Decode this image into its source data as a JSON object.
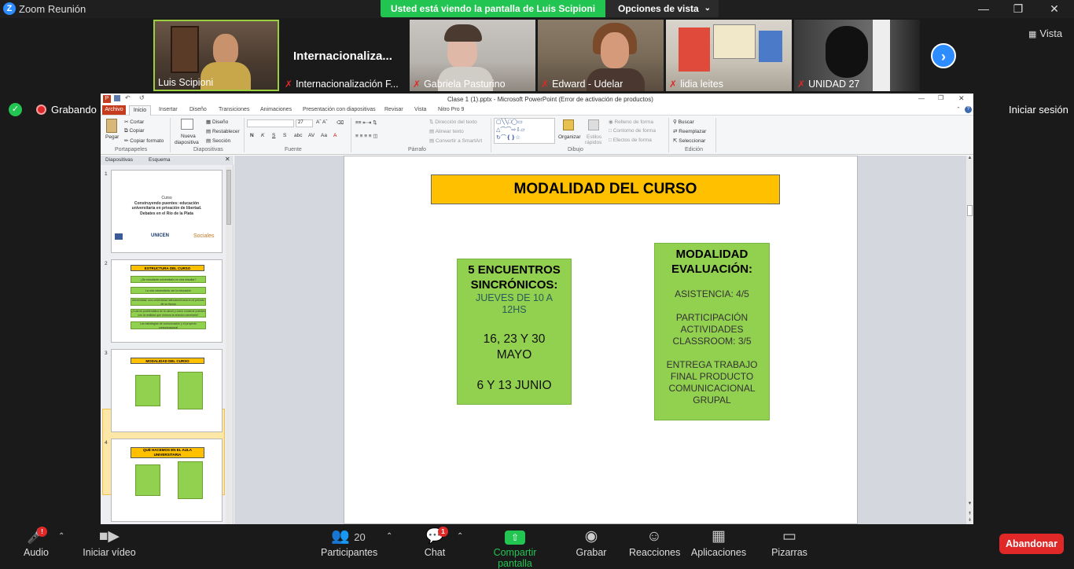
{
  "window": {
    "title": "Zoom Reunión",
    "share_banner": "Usted está viendo la pantalla de Luis Scipioni",
    "view_options": "Opciones de vista",
    "vista": "Vista"
  },
  "participants": [
    {
      "name": "Luis Scipioni",
      "muted": false
    },
    {
      "name": "Internacionalización F...",
      "muted": true,
      "display": "Internacionaliza..."
    },
    {
      "name": "Gabriela Pasturino",
      "muted": true
    },
    {
      "name": "Edward - Udelar",
      "muted": true
    },
    {
      "name": "lidia leites",
      "muted": true
    },
    {
      "name": "UNIDAD 27",
      "muted": true
    }
  ],
  "status": {
    "recording": "Grabando",
    "signin": "Iniciar sesión"
  },
  "ppt": {
    "title": "Clase 1 (1).pptx - Microsoft PowerPoint (Error de activación de productos)",
    "tabs": [
      "Archivo",
      "Inicio",
      "Insertar",
      "Diseño",
      "Transiciones",
      "Animaciones",
      "Presentación con diapositivas",
      "Revisar",
      "Vista",
      "Nitro Pro 9"
    ],
    "ribbon": {
      "portapapeles": {
        "label": "Portapapeles",
        "pegar": "Pegar",
        "cortar": "Cortar",
        "copiar": "Copiar",
        "copiar_formato": "Copiar formato"
      },
      "diapositivas": {
        "label": "Diapositivas",
        "nueva": "Nueva",
        "nueva2": "diapositiva",
        "diseno": "Diseño",
        "restablecer": "Restablecer",
        "seccion": "Sección"
      },
      "fuente": {
        "label": "Fuente",
        "size": "27"
      },
      "parrafo": {
        "label": "Párrafo",
        "direccion": "Dirección del texto",
        "alinear": "Alinear texto",
        "smartart": "Convertir a SmartArt"
      },
      "dibujo": {
        "label": "Dibujo",
        "organizar": "Organizar",
        "estilos": "Estilos",
        "estilos2": "rápidos",
        "relleno": "Relleno de forma",
        "contorno": "Contorno de forma",
        "efectos": "Efectos de forma"
      },
      "edicion": {
        "label": "Edición",
        "buscar": "Buscar",
        "reemplazar": "Reemplazar",
        "seleccionar": "Seleccionar"
      }
    },
    "panel_tabs": [
      "Diapositivas",
      "Esquema"
    ],
    "thumb1": {
      "line1": "Curso",
      "line2": "Construyendo puentes: educación",
      "line3": "universitaria en privación de libertad.",
      "line4": "Debates en el Río de la Plata",
      "logo_unicen": "UNICEN",
      "logo_sociales": "Sociales"
    },
    "thumb2": {
      "title": "ESTRUCTURA DEL CURSO",
      "items": [
        "¿De estudiante universitario en ruta estudiar?",
        "La ruta universitaria: ser la educación",
        "Universidad: una universidad latinoamericana en el período de su época",
        "¿Cuál es problemática de la cárcel y cómo construir puentes con la realidad que vivimos la relación carcelaria?",
        "Las estrategias de comunicación y el proyecto comunicacional"
      ]
    },
    "thumb3": {
      "title": "MODALIDAD DEL CURSO"
    },
    "thumb4": {
      "title": "QUÉ HACEMOS EN EL AULA UNIVERSITARIA"
    },
    "slide_numbers": [
      "1",
      "2",
      "3",
      "4"
    ],
    "slide": {
      "title": "MODALIDAD DEL CURSO",
      "left": {
        "heading1": "5 ENCUENTROS",
        "heading2": "SINCRÓNICOS:",
        "sub1": "JUEVES DE 10 A",
        "sub2": "12HS",
        "dates1a": "16, 23 Y 30",
        "dates1b": "MAYO",
        "dates2": "6 Y 13 JUNIO"
      },
      "right": {
        "heading1": "MODALIDAD",
        "heading2": "EVALUACIÓN:",
        "asistencia": "ASISTENCIA: 4/5",
        "part1": "PARTICIPACIÓN",
        "part2": "ACTIVIDADES",
        "part3": "CLASSROOM: 3/5",
        "entrega1": "ENTREGA TRABAJO",
        "entrega2": "FINAL PRODUCTO",
        "entrega3": "COMUNICACIONAL",
        "entrega4": "GRUPAL"
      }
    }
  },
  "toolbar": {
    "audio": "Audio",
    "video": "Iniciar vídeo",
    "participants": "Participantes",
    "participants_count": "20",
    "chat": "Chat",
    "chat_badge": "1",
    "audio_badge": "!",
    "share": "Compartir pantalla",
    "record": "Grabar",
    "reactions": "Reacciones",
    "apps": "Aplicaciones",
    "whiteboards": "Pizarras",
    "end": "Abandonar"
  },
  "colors": {
    "zoom_blue": "#2d8cff",
    "share_green": "#23c552",
    "end_red": "#e02828",
    "slide_yellow": "#ffc000",
    "slide_green": "#92d050"
  }
}
